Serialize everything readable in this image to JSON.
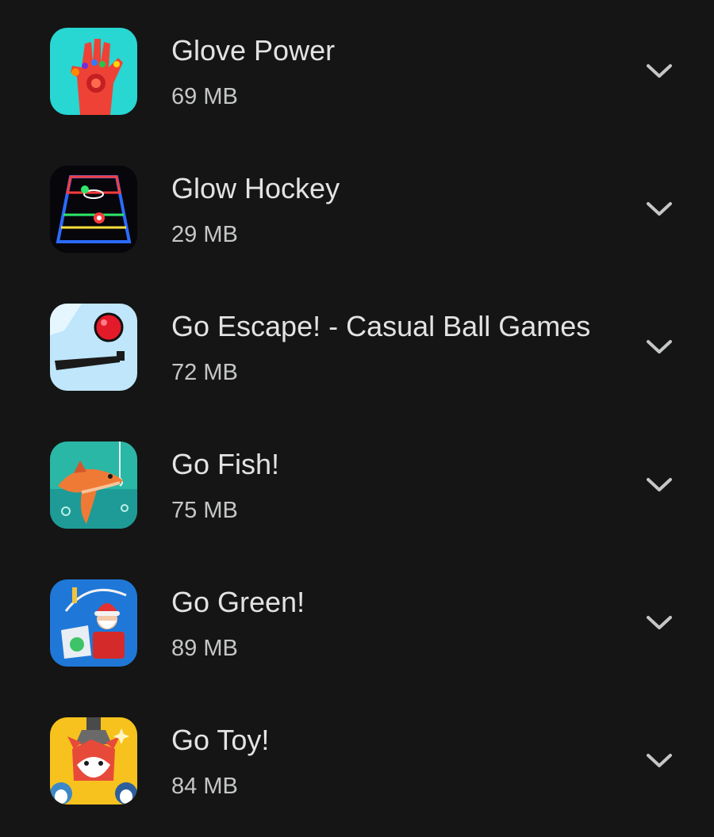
{
  "apps": [
    {
      "name": "Glove Power",
      "size": "69 MB",
      "icon": "glove-power-icon"
    },
    {
      "name": "Glow Hockey",
      "size": "29 MB",
      "icon": "glow-hockey-icon"
    },
    {
      "name": "Go Escape! - Casual Ball Games",
      "size": "72 MB",
      "icon": "go-escape-icon"
    },
    {
      "name": "Go Fish!",
      "size": "75 MB",
      "icon": "go-fish-icon"
    },
    {
      "name": "Go Green!",
      "size": "89 MB",
      "icon": "go-green-icon"
    },
    {
      "name": "Go Toy!",
      "size": "84 MB",
      "icon": "go-toy-icon"
    }
  ],
  "expand_icon": "chevron-down-icon",
  "colors": {
    "background": "#151515",
    "title": "#e3e3e3",
    "subtitle": "#c4c7c5",
    "chevron": "#c4c7c5"
  }
}
